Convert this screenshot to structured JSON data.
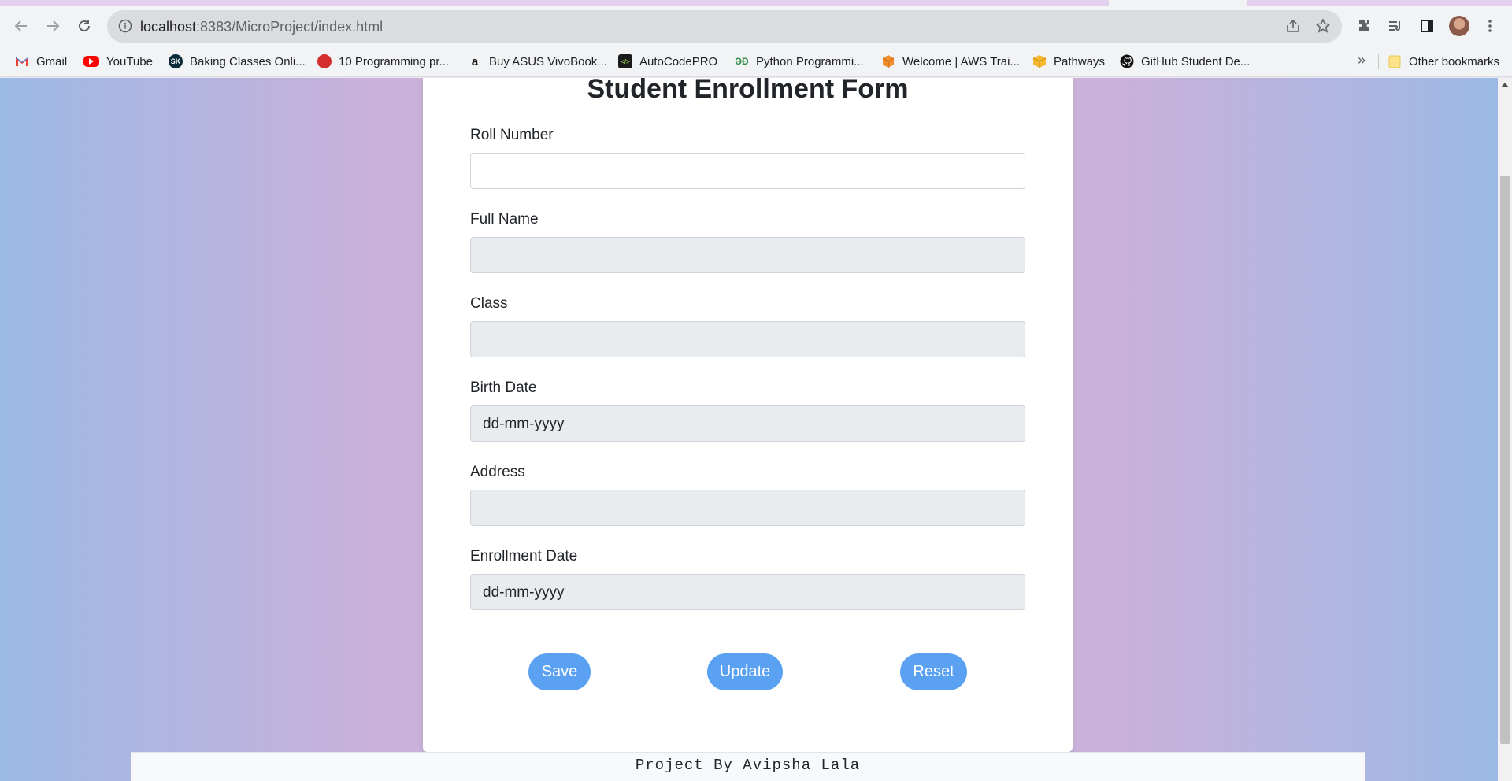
{
  "browser": {
    "url_host": "localhost",
    "url_rest": ":8383/MicroProject/index.html",
    "bookmarks": [
      {
        "label": "Gmail",
        "icon": "gmail-icon",
        "color": "#ea4335"
      },
      {
        "label": "YouTube",
        "icon": "youtube-icon",
        "color": "#ff0000"
      },
      {
        "label": "Baking Classes Onli...",
        "icon": "sk-icon",
        "color": "#0b2a3a"
      },
      {
        "label": "10 Programming pr...",
        "icon": "red-circle-icon",
        "color": "#d32f2f"
      },
      {
        "label": "Buy ASUS VivoBook...",
        "icon": "amazon-icon",
        "color": "#111111"
      },
      {
        "label": "AutoCodePRO",
        "icon": "code-icon",
        "color": "#1b1b1b"
      },
      {
        "label": "Python Programmi...",
        "icon": "geeksforgeeks-icon",
        "color": "#2f8d46"
      },
      {
        "label": "Welcome | AWS Trai...",
        "icon": "aws-cube-icon",
        "color": "#f08d2c"
      },
      {
        "label": "Pathways",
        "icon": "box-icon",
        "color": "#f5b82e"
      },
      {
        "label": "GitHub Student De...",
        "icon": "github-icon",
        "color": "#111111"
      }
    ],
    "more_chevron": "»",
    "other_bookmarks": "Other bookmarks"
  },
  "form": {
    "title": "Student Enrollment Form",
    "fields": [
      {
        "label": "Roll Number",
        "value": "",
        "enabled": true
      },
      {
        "label": "Full Name",
        "value": "",
        "enabled": false
      },
      {
        "label": "Class",
        "value": "",
        "enabled": false
      },
      {
        "label": "Birth Date",
        "value": "dd-mm-yyyy",
        "enabled": false
      },
      {
        "label": "Address",
        "value": "",
        "enabled": false
      },
      {
        "label": "Enrollment Date",
        "value": "dd-mm-yyyy",
        "enabled": false
      }
    ],
    "buttons": {
      "save": "Save",
      "update": "Update",
      "reset": "Reset"
    }
  },
  "footer": {
    "text": "Project By Avipsha Lala"
  },
  "colors": {
    "button": "#5aa1f2",
    "gradient_edge": "#9cb9e6",
    "gradient_mid": "#c9b1d9"
  }
}
